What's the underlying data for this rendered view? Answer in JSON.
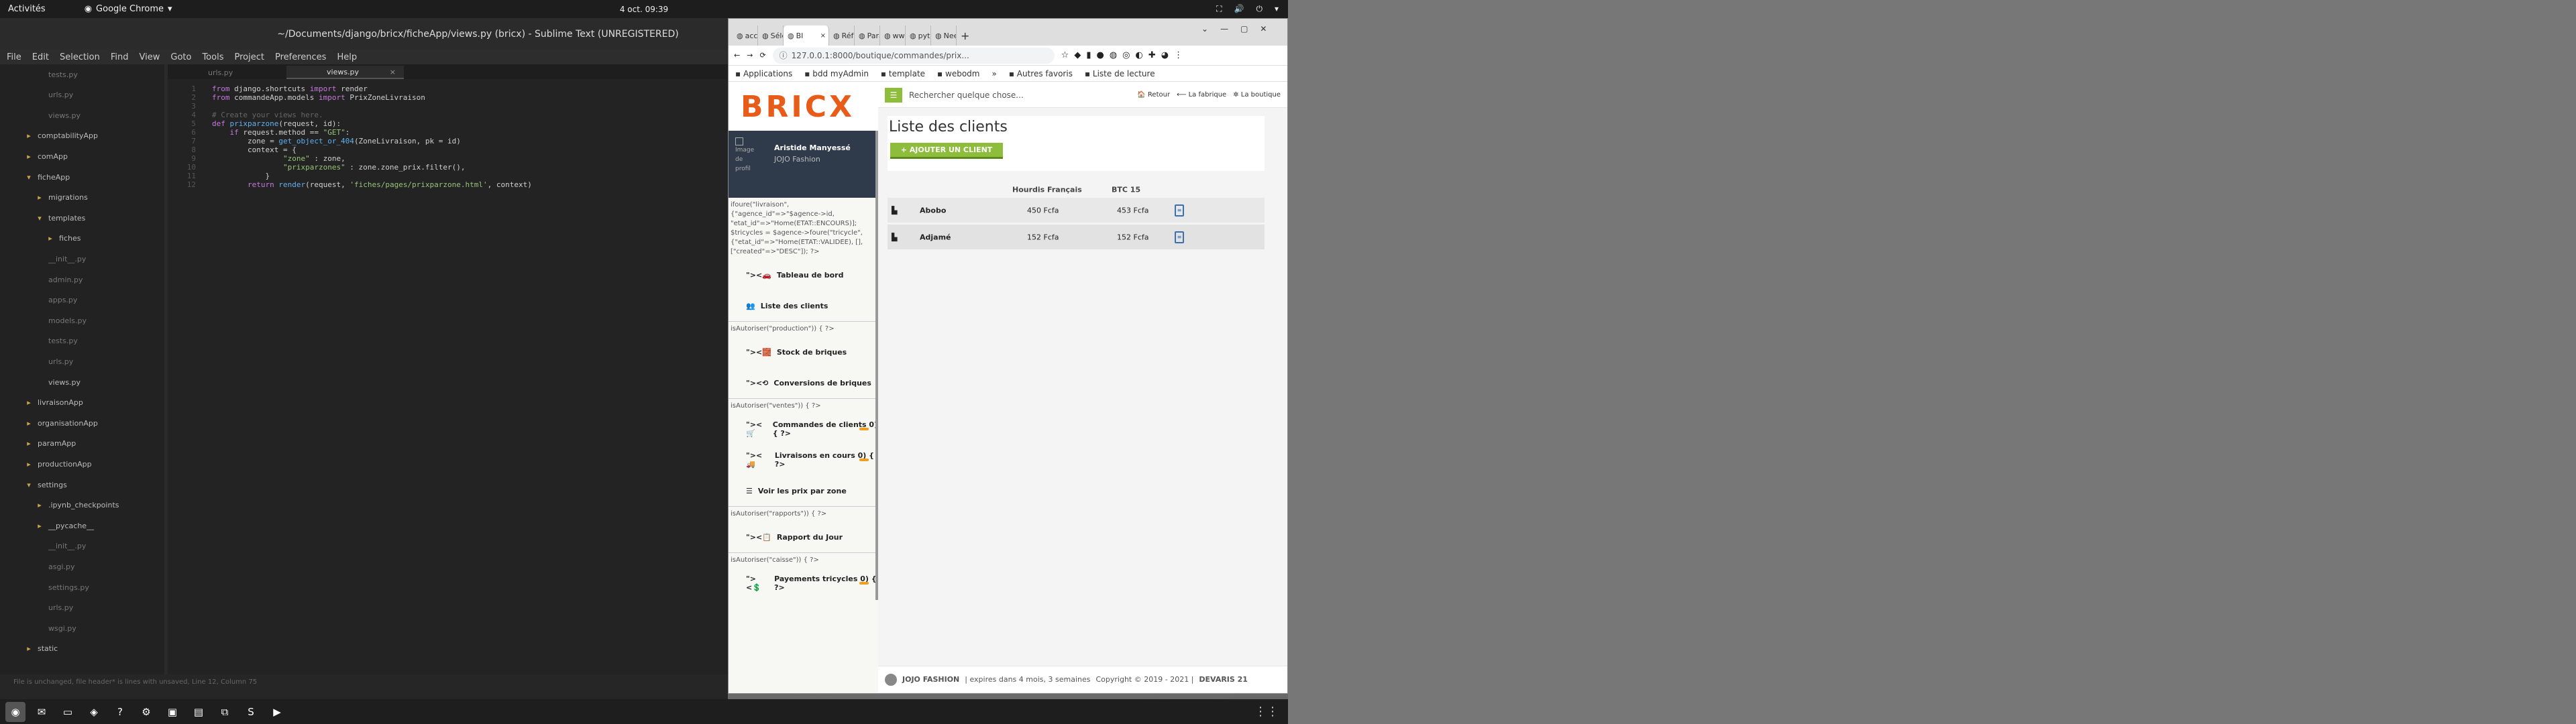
{
  "topbar": {
    "activities": "Activités",
    "app": "Google Chrome",
    "clock": "4 oct.  09:39"
  },
  "sublime": {
    "title": "~/Documents/django/bricx/ficheApp/views.py (bricx) - Sublime Text (UNREGISTERED)",
    "menu": [
      "File",
      "Edit",
      "Selection",
      "Find",
      "View",
      "Goto",
      "Tools",
      "Project",
      "Preferences",
      "Help"
    ],
    "sidebar": [
      {
        "label": "tests.py",
        "level": 2,
        "folder": false,
        "dim": true,
        "dot": false
      },
      {
        "label": "urls.py",
        "level": 2,
        "folder": false,
        "dim": true,
        "dot": true
      },
      {
        "label": "views.py",
        "level": 2,
        "folder": false,
        "dim": true,
        "dot": true
      },
      {
        "label": "comptabilityApp",
        "level": 1,
        "folder": true,
        "dim": false,
        "dot": true
      },
      {
        "label": "comApp",
        "level": 1,
        "folder": true,
        "dim": false,
        "dot": true
      },
      {
        "label": "ficheApp",
        "level": 1,
        "folder": true,
        "open": true,
        "dim": false,
        "dot": true
      },
      {
        "label": "migrations",
        "level": 2,
        "folder": true,
        "dim": false,
        "dot": true
      },
      {
        "label": "templates",
        "level": 2,
        "folder": true,
        "open": true,
        "dim": false,
        "dot": false
      },
      {
        "label": "fiches",
        "level": 3,
        "folder": true,
        "dim": false,
        "dot": false
      },
      {
        "label": "__init__.py",
        "level": 2,
        "folder": false,
        "dim": true,
        "dot": false
      },
      {
        "label": "admin.py",
        "level": 2,
        "folder": false,
        "dim": true,
        "dot": true
      },
      {
        "label": "apps.py",
        "level": 2,
        "folder": false,
        "dim": true,
        "dot": false
      },
      {
        "label": "models.py",
        "level": 2,
        "folder": false,
        "dim": true,
        "dot": true
      },
      {
        "label": "tests.py",
        "level": 2,
        "folder": false,
        "dim": true,
        "dot": false
      },
      {
        "label": "urls.py",
        "level": 2,
        "folder": false,
        "dim": true,
        "dot": true
      },
      {
        "label": "views.py",
        "level": 2,
        "folder": false,
        "dim": false,
        "dot": true
      },
      {
        "label": "livraisonApp",
        "level": 1,
        "folder": true,
        "dim": false,
        "dot": false
      },
      {
        "label": "organisationApp",
        "level": 1,
        "folder": true,
        "dim": false,
        "dot": true
      },
      {
        "label": "paramApp",
        "level": 1,
        "folder": true,
        "dim": false,
        "dot": true
      },
      {
        "label": "productionApp",
        "level": 1,
        "folder": true,
        "dim": false,
        "dot": true
      },
      {
        "label": "settings",
        "level": 1,
        "folder": true,
        "open": true,
        "dim": false,
        "dot": true
      },
      {
        "label": ".ipynb_checkpoints",
        "level": 2,
        "folder": true,
        "dim": false,
        "dot": false
      },
      {
        "label": "__pycache__",
        "level": 2,
        "folder": true,
        "dim": false,
        "dot": false
      },
      {
        "label": "__init__.py",
        "level": 2,
        "folder": false,
        "dim": true,
        "dot": false
      },
      {
        "label": "asgi.py",
        "level": 2,
        "folder": false,
        "dim": true,
        "dot": false
      },
      {
        "label": "settings.py",
        "level": 2,
        "folder": false,
        "dim": true,
        "dot": true
      },
      {
        "label": "urls.py",
        "level": 2,
        "folder": false,
        "dim": true,
        "dot": true
      },
      {
        "label": "wsgi.py",
        "level": 2,
        "folder": false,
        "dim": true,
        "dot": false
      },
      {
        "label": "static",
        "level": 1,
        "folder": true,
        "dim": false,
        "dot": true
      }
    ],
    "tabs": [
      {
        "label": "urls.py",
        "active": false
      },
      {
        "label": "views.py",
        "active": true
      }
    ],
    "lines": [
      {
        "n": "1",
        "html": "<span class='kw'>from</span> django.shortcuts <span class='kw'>import</span> render"
      },
      {
        "n": "2",
        "html": "<span class='kw'>from</span> commandeApp.models <span class='kw'>import</span> PrixZoneLivraison"
      },
      {
        "n": "3",
        "html": ""
      },
      {
        "n": "4",
        "html": "<span class='cm'># Create your views here.</span>"
      },
      {
        "n": "5",
        "html": "<span class='kw'>def</span> <span class='fn'>prixparzone</span>(request, id):"
      },
      {
        "n": "6",
        "html": "    <span class='kw'>if</span> request.method == <span class='str'>\"GET\"</span>:"
      },
      {
        "n": "7",
        "html": "        zone = <span class='fn'>get_object_or_404</span>(ZoneLivraison, pk = id)"
      },
      {
        "n": "8",
        "html": "        context = {"
      },
      {
        "n": "9",
        "html": "                <span class='str'>\"zone\"</span> : zone,"
      },
      {
        "n": "10",
        "html": "                <span class='str'>\"prixparzones\"</span> : zone.zone_prix.filter(),"
      },
      {
        "n": "11",
        "html": "            }"
      },
      {
        "n": "12",
        "html": "        <span class='kw'>return</span> <span class='fn'>render</span>(request, <span class='str'>'fiches/pages/prixparzone.html'</span>, context)"
      }
    ],
    "status": "File is unchanged, file header* is lines with unsaved, Line 12, Column 75"
  },
  "chrome": {
    "tabs": [
      {
        "label": "acco",
        "active": false
      },
      {
        "label": "Séle",
        "active": false
      },
      {
        "label": "BI",
        "active": true
      },
      {
        "label": "Réfé",
        "active": false
      },
      {
        "label": "Para",
        "active": false
      },
      {
        "label": "www",
        "active": false
      },
      {
        "label": "pyth",
        "active": false
      },
      {
        "label": "Need",
        "active": false
      }
    ],
    "url": "127.0.0.1:8000/boutique/commandes/prix...",
    "bookmarks": [
      "Applications",
      "bdd myAdmin",
      "template",
      "webodm",
      "»",
      "Autres favoris",
      "Liste de lecture"
    ]
  },
  "app": {
    "logo": "BRICX",
    "user": {
      "image_alt": "Image de profil",
      "name": "Aristide Manyessé",
      "company": "JOJO Fashion"
    },
    "nav": [
      {
        "type": "text",
        "text": "ifoure(\"livraison\", {\"agence_id\"=>\"$agence->id, \"etat_id\"=>\"Home(ETAT::ENCOURS)]; $tricycles = $agence->foure(\"tricycle\", {\"etat_id\"=>\"Home(ETAT::VALIDEE), [], [\"created\"=>\"DESC\"]); ?>"
      },
      {
        "type": "item",
        "icon": "\"><🚗",
        "label": "Tableau de bord",
        "badge": false
      },
      {
        "type": "item",
        "icon": "👥",
        "label": "Liste des clients",
        "badge": false
      },
      {
        "type": "sep"
      },
      {
        "type": "text",
        "text": "isAutoriser(\"production\")) { ?>"
      },
      {
        "type": "item",
        "icon": "\"><🧱",
        "label": "Stock de briques",
        "badge": false
      },
      {
        "type": "item",
        "icon": "\"><⟲",
        "label": "Conversions de briques",
        "badge": false
      },
      {
        "type": "sep"
      },
      {
        "type": "text",
        "text": "isAutoriser(\"ventes\")) { ?>"
      },
      {
        "type": "item",
        "icon": "\"><🛒",
        "label": "Commandes de clients 0) { ?>",
        "badge": true
      },
      {
        "type": "item",
        "icon": "\"><🚚",
        "label": "Livraisons en cours 0) { ?>",
        "badge": true
      },
      {
        "type": "item",
        "icon": "☰",
        "label": "Voir les prix par zone",
        "badge": false
      },
      {
        "type": "sep"
      },
      {
        "type": "text",
        "text": "isAutoriser(\"rapports\")) { ?>"
      },
      {
        "type": "item",
        "icon": "\"><📋",
        "label": "Rapport du Jour",
        "badge": false
      },
      {
        "type": "sep"
      },
      {
        "type": "text",
        "text": "isAutoriser(\"caisse\")) { ?>"
      },
      {
        "type": "item",
        "icon": "\"><💲",
        "label": "Payements tricycles 0) { ?>",
        "badge": true
      }
    ],
    "search_placeholder": "Rechercher quelque chose...",
    "links": [
      "Retour",
      "La fabrique",
      "La boutique"
    ],
    "page_title": "Liste des clients",
    "add_button": "+ AJOUTER UN CLIENT",
    "table": {
      "headers": [
        "Hourdis Français",
        "BTC 15"
      ],
      "rows": [
        {
          "name": "Abobo",
          "c1": "450 Fcfa",
          "c2": "453 Fcfa"
        },
        {
          "name": "Adjamé",
          "c1": "152 Fcfa",
          "c2": "152 Fcfa"
        }
      ]
    },
    "footer": {
      "company": "JOJO FASHION",
      "expiry": "| expires dans 4 mois, 3 semaines",
      "copyright": "Copyright © 2019 - 2021 |",
      "brand": "DEVARIS 21"
    }
  }
}
